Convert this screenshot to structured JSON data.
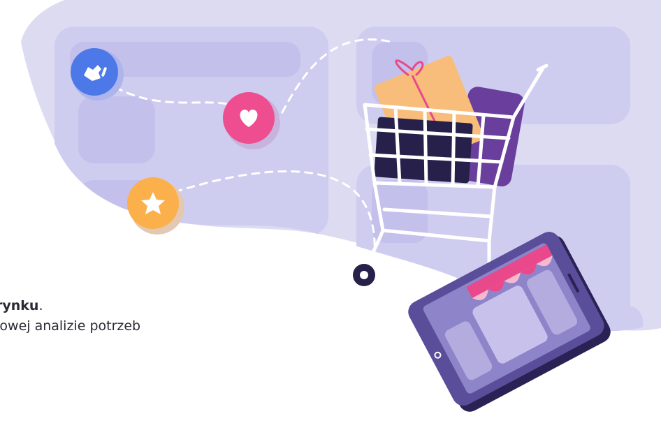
{
  "text": {
    "line1_bold": "rynku",
    "line1_suffix": ".",
    "line2": "łowej analizie potrzeb"
  },
  "icons": [
    "hand-icon",
    "heart-icon",
    "star-icon",
    "shopping-cart-icon",
    "gift-box-icon",
    "smartphone-icon",
    "store-awning-icon"
  ],
  "colors": {
    "blob": "#d9d8f1",
    "panel": "#c9c6ee",
    "blue_badge": "#4d79e8",
    "pink_badge": "#ee4d8f",
    "orange_badge": "#fbb04c",
    "phone_body": "#5a4d99",
    "phone_dark": "#2a2154",
    "cart_white": "#ffffff",
    "cart_dark": "#26204a",
    "gift_orange": "#f8bd7a",
    "gift_purple": "#6a3e9c",
    "awning_pink": "#e9488a"
  }
}
